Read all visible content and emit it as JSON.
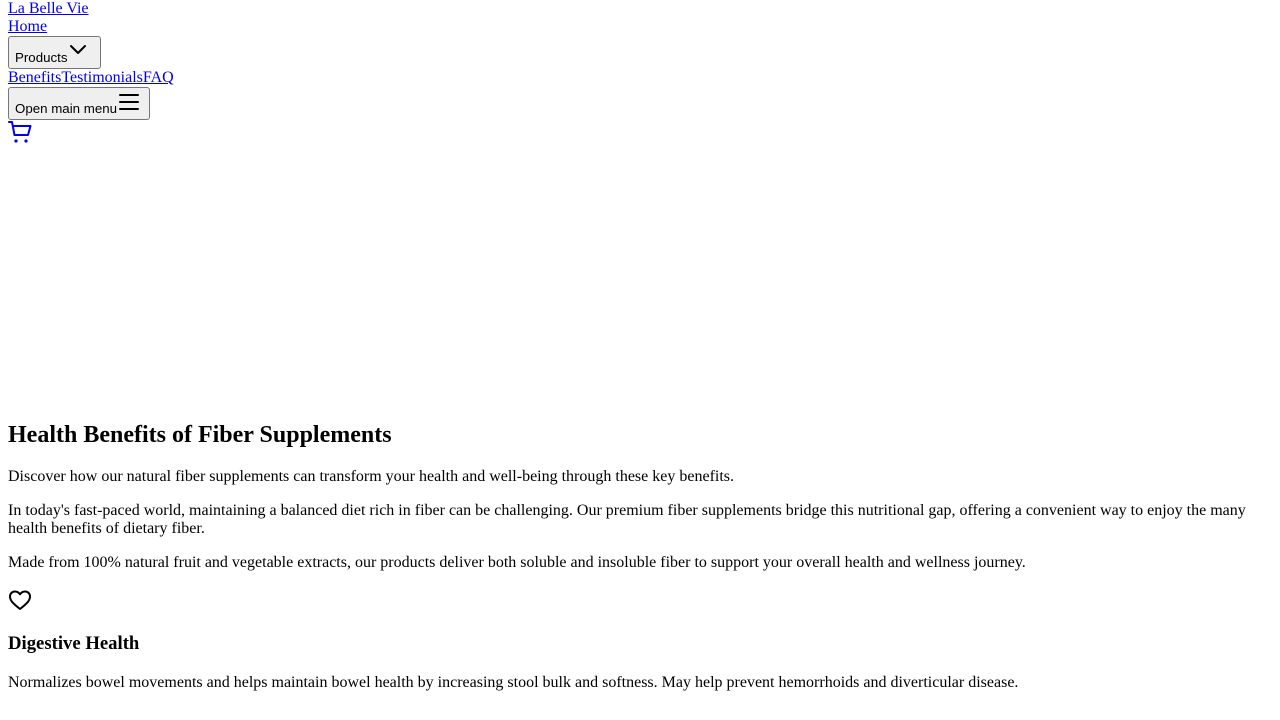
{
  "nav": {
    "brand": "La Belle Vie",
    "home": "Home",
    "products_button": "Products",
    "links": [
      "Benefits",
      "Testimonials",
      "FAQ"
    ],
    "menu_button": "Open main menu",
    "icons": {
      "products_chevron": "chevron-down-icon",
      "menu": "hamburger-menu-icon",
      "cart": "shopping-cart-icon"
    }
  },
  "main": {
    "title": "Health Benefits of Fiber Supplements",
    "intro": "Discover how our natural fiber supplements can transform your health and well-being through these key benefits.",
    "paragraph_1": "In today's fast-paced world, maintaining a balanced diet rich in fiber can be challenging. Our premium fiber supplements bridge this nutritional gap, offering a convenient way to enjoy the many health benefits of dietary fiber.",
    "paragraph_2": "Made from 100% natural fruit and vegetable extracts, our products deliver both soluble and insoluble fiber to support your overall health and wellness journey.",
    "benefits": [
      {
        "icon": "heart-icon",
        "title": "Digestive Health",
        "description": "Normalizes bowel movements and helps maintain bowel health by increasing stool bulk and softness. May help prevent hemorrhoids and diverticular disease."
      }
    ]
  },
  "colors": {
    "link": "#0000ee",
    "text": "#000000",
    "button_bg": "#efefef",
    "button_border": "#767676"
  }
}
